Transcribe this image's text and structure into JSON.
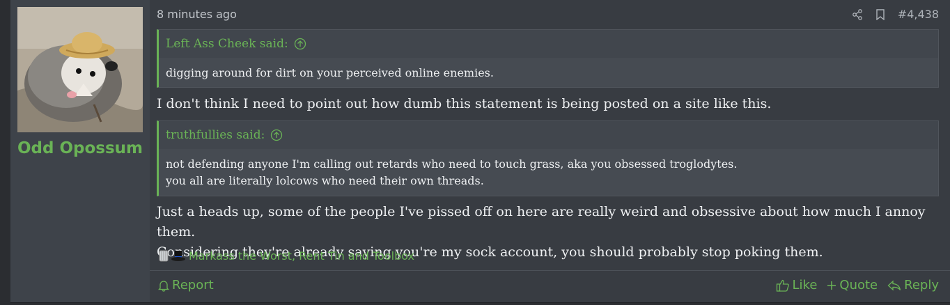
{
  "user": {
    "name": "Odd Opossum",
    "avatar_icon": "opossum-with-straw-hat-avatar"
  },
  "post": {
    "time": "8 minutes ago",
    "number": "#4,438",
    "share_icon": "share-icon",
    "bookmark_icon": "bookmark-icon"
  },
  "quotes": [
    {
      "author": "Left Ass Cheek said:",
      "lines": [
        "digging around for dirt on your perceived online enemies."
      ]
    },
    {
      "author": "truthfullies said:",
      "lines": [
        "not defending anyone I'm calling out retards who need to touch grass, aka you obsessed troglodytes.",
        "you all are literally lolcows who need their own threads."
      ]
    }
  ],
  "body": {
    "para1": "I don't think I need to point out how dumb this statement is being posted on a site like this.",
    "para2_line1": "Just a heads up, some of the people I've pissed off on here are really weird and obsessive about how much I annoy them.",
    "para2_line2": "Considering they're already saying you're my sock account, you should probably stop poking them."
  },
  "reactions": {
    "text": "Markass the Worst, Rent Tin and Toolbox",
    "icons": [
      "tin-can-reaction-icon",
      "top-hat-reaction-icon"
    ]
  },
  "footer": {
    "report": "Report",
    "like": "Like",
    "quote": "Quote",
    "reply": "Reply"
  },
  "colors": {
    "accent": "#6ab356",
    "background": "#383c42",
    "quote_bg": "#464b52"
  }
}
